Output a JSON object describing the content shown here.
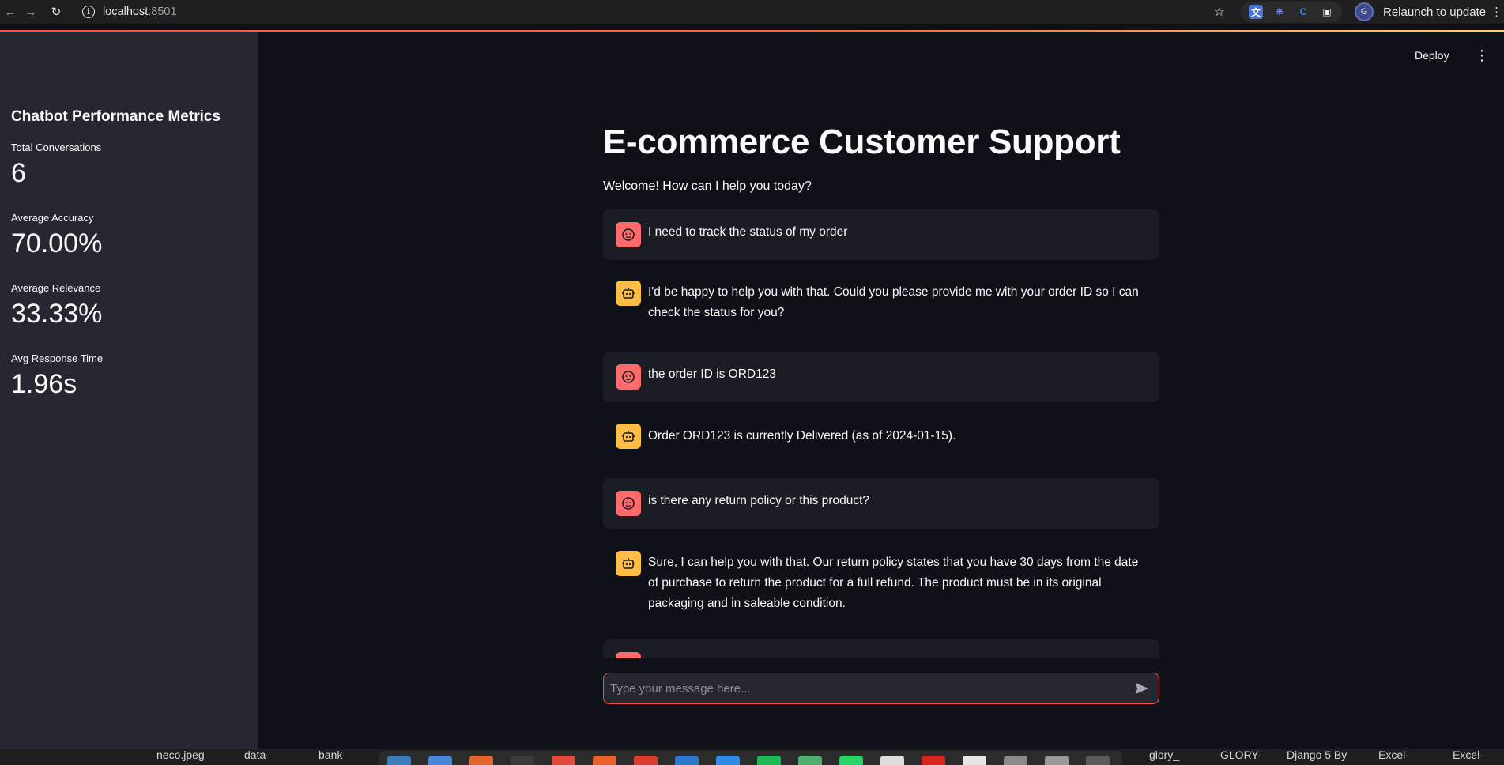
{
  "browser": {
    "url_host": "localhost",
    "url_port": ":8501",
    "profile_initial": "G",
    "relaunch_label": "Relaunch to update"
  },
  "sidebar": {
    "title": "Chatbot Performance Metrics",
    "metrics": [
      {
        "label": "Total Conversations",
        "value": "6"
      },
      {
        "label": "Average Accuracy",
        "value": "70.00%"
      },
      {
        "label": "Average Relevance",
        "value": "33.33%"
      },
      {
        "label": "Avg Response Time",
        "value": "1.96s"
      }
    ]
  },
  "header": {
    "deploy_label": "Deploy"
  },
  "main": {
    "title": "E-commerce Customer Support",
    "welcome": "Welcome! How can I help you today?"
  },
  "messages": [
    {
      "role": "user",
      "text": "I need to track the status of my order"
    },
    {
      "role": "assistant",
      "text": "I'd be happy to help you with that. Could you please provide me with your order ID so I can check the status for you?"
    },
    {
      "role": "user",
      "text": "the order ID is ORD123"
    },
    {
      "role": "assistant",
      "text": "Order ORD123 is currently Delivered (as of 2024-01-15)."
    },
    {
      "role": "user",
      "text": "is there any return policy or this product?"
    },
    {
      "role": "assistant",
      "text": "Sure, I can help you with that. Our return policy states that you have 30 days from the date of purchase to return the product for a full refund. The product must be in its original packaging and in saleable condition."
    },
    {
      "role": "user",
      "text": ""
    }
  ],
  "chat_input": {
    "placeholder": "Type your message here..."
  },
  "taskbar": {
    "files": [
      "neco.jpeg",
      "data-",
      "bank-",
      "glory_",
      "GLORY-",
      "Django 5 By",
      "Excel-",
      "Excel-"
    ]
  },
  "colors": {
    "accent": "#ff4b4b",
    "user_avatar": "#ff6b6b",
    "bot_avatar": "#ffbd45",
    "sidebar_bg": "#262730",
    "main_bg": "#0e1117"
  }
}
